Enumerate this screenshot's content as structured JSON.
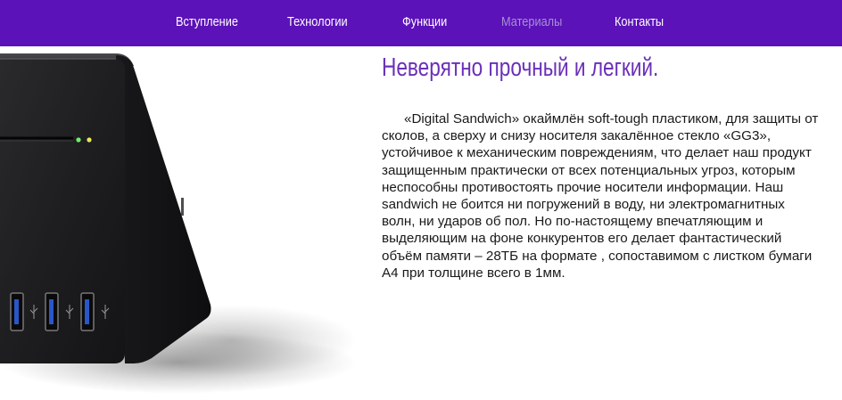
{
  "nav": {
    "items": [
      {
        "label": "Вступление"
      },
      {
        "label": "Технологии"
      },
      {
        "label": "Функции"
      },
      {
        "label": "Материалы"
      },
      {
        "label": "Контакты"
      }
    ],
    "active_index": 3,
    "background_color": "#5b12b8",
    "active_color": "#a98ed6"
  },
  "product_image": {
    "icons": [
      "usb-port-icon",
      "usb-symbol-icon",
      "status-led-icon"
    ]
  },
  "content": {
    "title": "Неверятно прочный и легкий.",
    "paragraph": "«Digital Sandwich» окаймлён soft-tough пластиком, для защиты от сколов, а сверху и снизу носителя закалённое стекло «GG3», устойчивое к механическим повреждениям, что делает наш продукт защищенным практически от всех потенциальных угроз, которым неспособны противостоять прочие носители информации. Наш sandwich не боится ни погружений в воду, ни электромагнитных волн, ни ударов об пол. Но по-настоящему впечатляющим и выделяющим на фоне конкурентов его делает фантастический объём памяти – 28ТБ на формате , сопоставимом с листком бумаги А4 при толщине всего в 1мм.",
    "title_color": "#6a30b8"
  }
}
